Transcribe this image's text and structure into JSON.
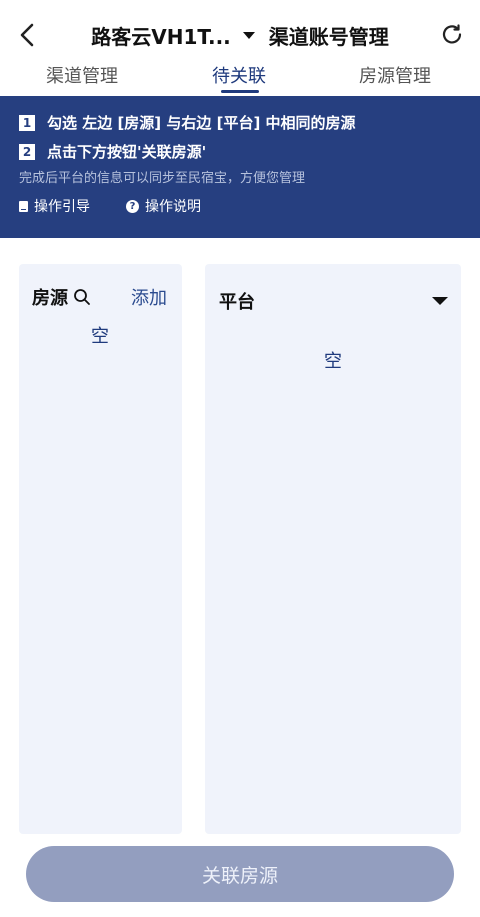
{
  "header": {
    "title": "路客云VH1T...",
    "subtitle": "渠道账号管理",
    "back_icon": "chevron-left-icon",
    "refresh_icon": "refresh-icon"
  },
  "tabs": [
    {
      "label": "渠道管理",
      "active": false
    },
    {
      "label": "待关联",
      "active": true
    },
    {
      "label": "房源管理",
      "active": false
    }
  ],
  "banner": {
    "step1_num": "1",
    "step1": "勾选 左边 [房源] 与右边 [平台] 中相同的房源",
    "step2_num": "2",
    "step2": "点击下方按钮'关联房源'",
    "hint": "完成后平台的信息可以同步至民宿宝，方便您管理",
    "guide_label": "操作引导",
    "help_label": "操作说明",
    "bg_color": "#263f80"
  },
  "left_panel": {
    "title": "房源",
    "add_label": "添加",
    "empty": "空"
  },
  "right_panel": {
    "title": "平台",
    "empty": "空"
  },
  "bottom_button": {
    "label": "关联房源",
    "color": "#939ebf"
  }
}
